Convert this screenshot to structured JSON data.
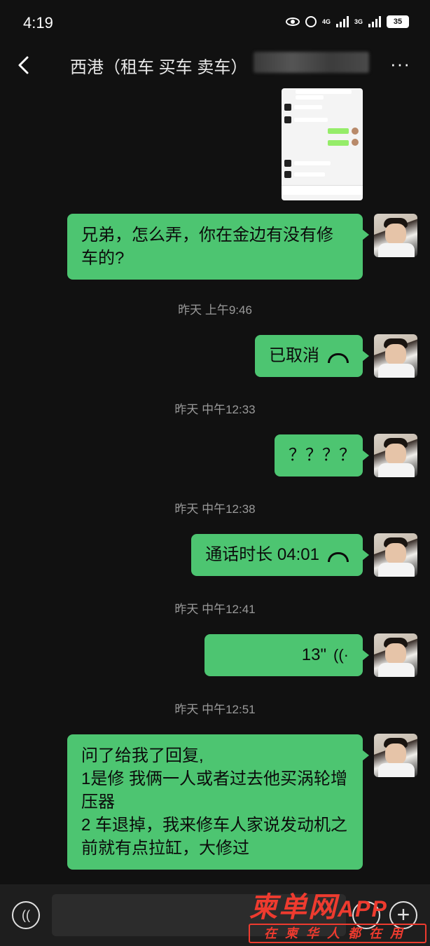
{
  "status_bar": {
    "time": "4:19",
    "network_1": "4G",
    "network_2": "3G",
    "battery": "35"
  },
  "nav": {
    "title": "西港（租车 买车 卖车）",
    "more": "···"
  },
  "messages": {
    "m1": "兄弟，怎么弄，你在金边有没有修车的?",
    "t1": "昨天 上午9:46",
    "m2": "已取消",
    "t2": "昨天 中午12:33",
    "m3": "？？？？",
    "t3": "昨天 中午12:38",
    "m4": "通话时长 04:01",
    "t4": "昨天 中午12:41",
    "m5": "13\"",
    "t5": "昨天 中午12:51",
    "m6_lines": [
      "问了给我了回复,",
      "1是修  我俩一人或者过去他买涡轮增压器",
      "2 车退掉，我来修车人家说发动机之前就有点拉缸，大修过"
    ]
  },
  "input": {
    "placeholder": ""
  },
  "watermark": {
    "main": "柬单网",
    "app": "APP",
    "sub": "在柬华人都在用"
  },
  "colors": {
    "bubble": "#4dc571",
    "background": "#111111",
    "watermark": "#ee3b2f"
  }
}
